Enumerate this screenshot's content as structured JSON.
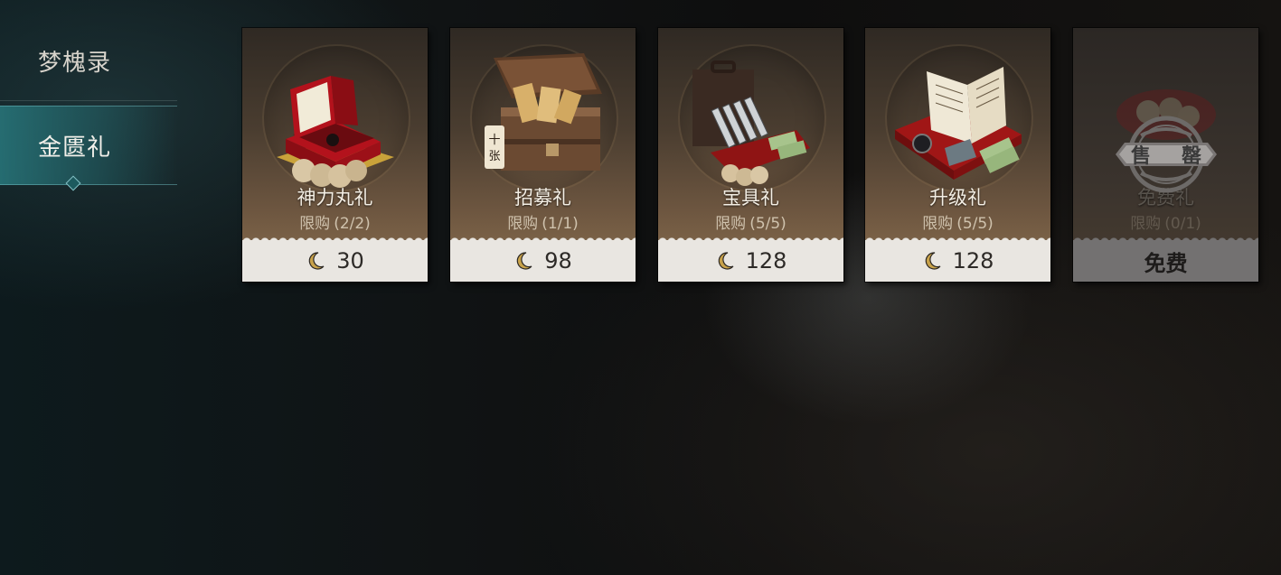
{
  "sidebar": {
    "items": [
      {
        "label": "梦槐录",
        "selected": false
      },
      {
        "label": "金匮礼",
        "selected": true
      }
    ]
  },
  "cards": [
    {
      "name": "神力丸礼",
      "limit_label": "限购",
      "limit": "(2/2)",
      "price": "30",
      "currency_icon": "crescent-moon-icon",
      "art": "red-jewelry-box"
    },
    {
      "name": "招募礼",
      "limit_label": "限购",
      "limit": "(1/1)",
      "price": "98",
      "currency_icon": "crescent-moon-icon",
      "art": "treasure-chest"
    },
    {
      "name": "宝具礼",
      "limit_label": "限购",
      "limit": "(5/5)",
      "price": "128",
      "currency_icon": "crescent-moon-icon",
      "art": "briefcase-vials"
    },
    {
      "name": "升级礼",
      "limit_label": "限购",
      "limit": "(5/5)",
      "price": "128",
      "currency_icon": "crescent-moon-icon",
      "art": "books-and-money"
    },
    {
      "name": "免费礼",
      "limit_label": "限购",
      "limit": "(0/1)",
      "price": "免费",
      "sold_out_stamp": "售罄",
      "art": "red-jewelry-box-faded"
    }
  ],
  "colors": {
    "accent": "#2f8a8f",
    "card_bottom": "#e9e6e1",
    "sold_out_bar": "#737171"
  }
}
